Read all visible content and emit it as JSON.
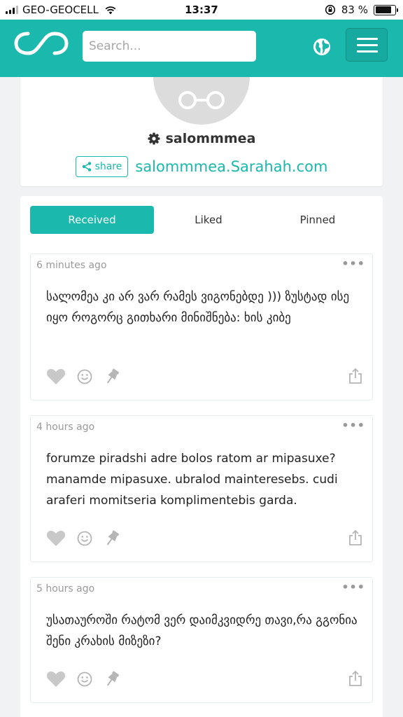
{
  "status_bar": {
    "carrier": "GEO-GEOCELL",
    "time": "13:37",
    "battery": "83 %",
    "battery_level": 0.83
  },
  "header": {
    "logo_icon": "infinity-logo-icon",
    "search": {
      "placeholder": "Search...",
      "value": ""
    },
    "globe_icon": "globe-icon",
    "menu_icon": "hamburger-menu-icon"
  },
  "profile": {
    "username": "salommmea",
    "share_label": "share",
    "link": "salommmea.Sarahah.com"
  },
  "tabs": [
    {
      "label": "Received",
      "active": true
    },
    {
      "label": "Liked",
      "active": false
    },
    {
      "label": "Pinned",
      "active": false
    }
  ],
  "messages": [
    {
      "time": "6 minutes ago",
      "text": "სალომეა კი არ ვარ რამეს ვიგონებდე ))) ზუსტად ისე იყო როგორც გითხარი მინიშნება: ხის კიბე"
    },
    {
      "time": "4 hours ago",
      "text": "forumze piradshi adre bolos ratom ar mipasuxe? manamde mipasuxe. ubralod mainteresebs. cudi araferi momitseria komplimentebis garda."
    },
    {
      "time": "5 hours ago",
      "text": "უსათაუროში რატომ ვერ დაიმკვიდრე თავი,რა გგონია შენი კრახის მიზეზი?"
    }
  ],
  "colors": {
    "accent": "#1ab8ad",
    "background": "#f1f2f4"
  }
}
